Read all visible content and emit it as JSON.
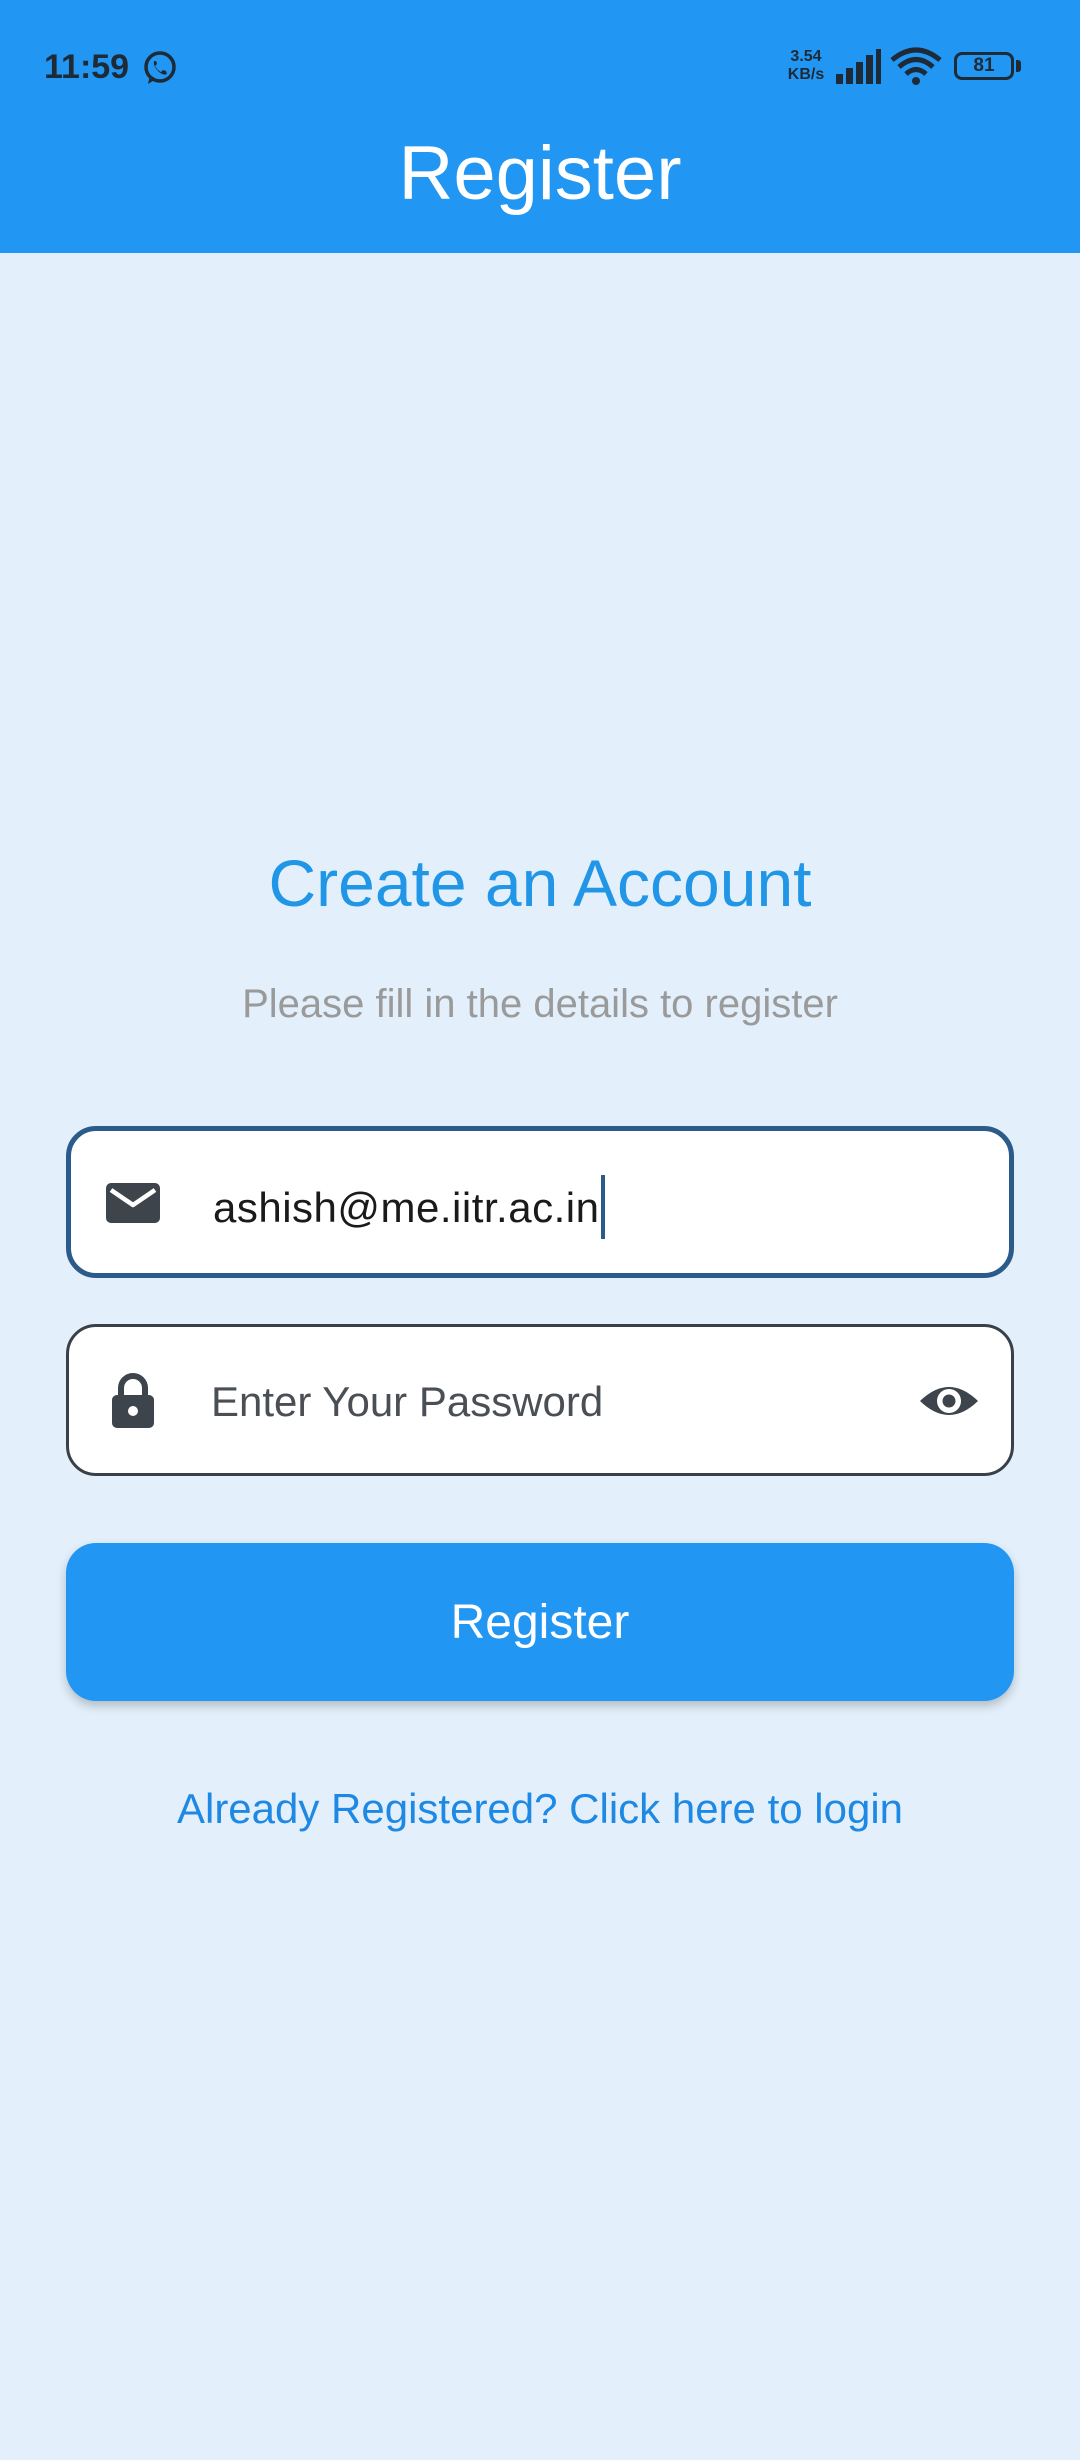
{
  "status_bar": {
    "time": "11:59",
    "net_speed_value": "3.54",
    "net_speed_unit": "KB/s",
    "battery": "81",
    "icons": [
      "whatsapp-icon",
      "signal-icon",
      "wifi-icon",
      "battery-icon"
    ]
  },
  "app_bar": {
    "title": "Register"
  },
  "form": {
    "heading": "Create an Account",
    "subheading": "Please fill in the details to register",
    "email": {
      "value": "ashish@me.iitr.ac.in",
      "icon": "mail-icon"
    },
    "password": {
      "placeholder": "Enter Your Password",
      "icon": "lock-icon",
      "toggle_icon": "eye-icon"
    },
    "register_label": "Register",
    "login_link": "Already Registered? Click here to login"
  },
  "colors": {
    "primary": "#2196f3",
    "background": "#e3f0fb",
    "heading": "#2196e6",
    "link": "#1e88e5",
    "field_focus_border": "#2b5b8a"
  }
}
